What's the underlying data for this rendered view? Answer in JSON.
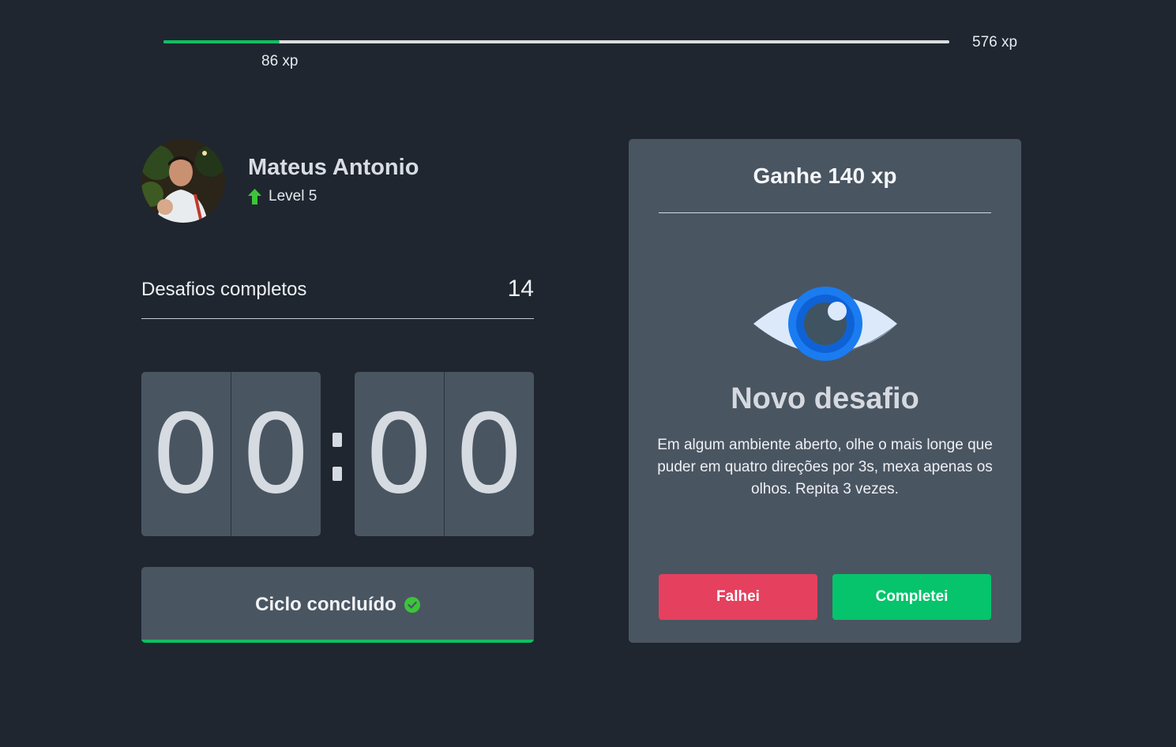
{
  "xp": {
    "current_label": "86 xp",
    "max_label": "576 xp",
    "progress": 0.148
  },
  "profile": {
    "name": "Mateus Antonio",
    "level_label": "Level 5",
    "level_icon": "level-up-arrow-icon"
  },
  "challenges": {
    "label": "Desafios completos",
    "count": "14"
  },
  "countdown": {
    "minute_left": "0",
    "minute_right": "0",
    "second_left": "0",
    "second_right": "0"
  },
  "cycle": {
    "label": "Ciclo concluído",
    "icon": "check-circle-icon",
    "progress": 1.0
  },
  "challenge_card": {
    "header": "Ganhe 140 xp",
    "icon": "eye-icon",
    "title": "Novo desafio",
    "description": "Em algum ambiente aberto, olhe o mais longe que puder em quatro direções por 3s, mexa apenas os olhos. Repita 3 vezes.",
    "fail_label": "Falhei",
    "done_label": "Completei"
  },
  "colors": {
    "background": "#1f262f",
    "panel": "#4a5562",
    "accent_green": "#0fbf62",
    "fail_red": "#e5405e",
    "done_green": "#05c46b"
  }
}
